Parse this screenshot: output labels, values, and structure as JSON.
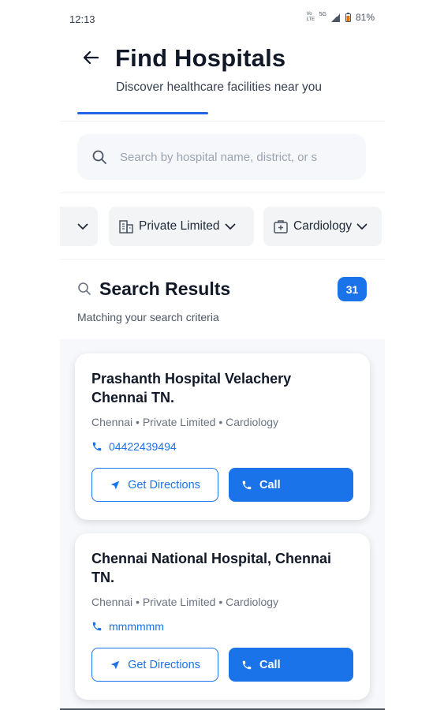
{
  "status_bar": {
    "time": "12:13",
    "network_label": "Vo LTE",
    "network_type": "5G",
    "battery": "81%"
  },
  "header": {
    "title": "Find Hospitals",
    "subtitle": "Discover healthcare facilities near you",
    "back_icon": "arrow-left-icon"
  },
  "search": {
    "placeholder": "Search by hospital name, district, or s",
    "value": ""
  },
  "filters": [
    {
      "label": ""
    },
    {
      "label": "Private Limited",
      "icon": "building-icon"
    },
    {
      "label": "Cardiology",
      "icon": "medical-plus-icon"
    }
  ],
  "results": {
    "title": "Search Results",
    "count": "31",
    "subtitle": "Matching your search criteria"
  },
  "hospitals": [
    {
      "name": "Prashanth Hospital Velachery Chennai TN.",
      "meta": "Chennai • Private Limited • Cardiology",
      "phone": "04422439494",
      "directions_label": "Get Directions",
      "call_label": "Call"
    },
    {
      "name": "Chennai National Hospital, Chennai TN.",
      "meta": "Chennai • Private Limited • Cardiology",
      "phone": "mmmmmm",
      "directions_label": "Get Directions",
      "call_label": "Call"
    }
  ],
  "colors": {
    "accent": "#1a73e8",
    "title_text": "#111827",
    "muted_text": "#6b7280",
    "results_bg": "#f6f8fb"
  }
}
